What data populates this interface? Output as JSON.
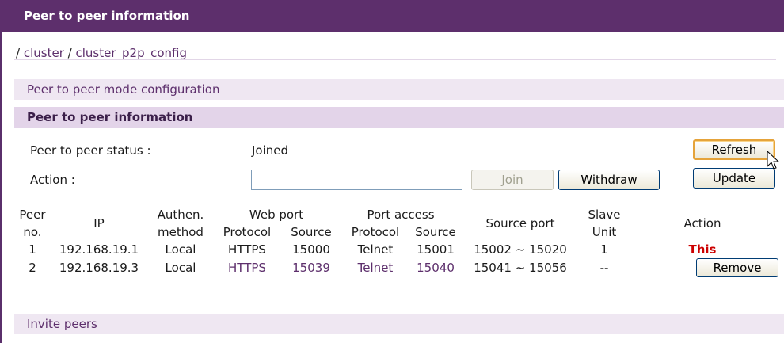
{
  "title": "Peer to peer information",
  "breadcrumb": {
    "sep": "/",
    "item1": "cluster",
    "item2": "cluster_p2p_config"
  },
  "sections": {
    "config": "Peer to peer mode configuration",
    "info": "Peer to peer information",
    "invite": "Invite peers"
  },
  "status": {
    "label": "Peer to peer status :",
    "value": "Joined"
  },
  "action": {
    "label": "Action :",
    "input_value": ""
  },
  "buttons": {
    "join": "Join",
    "withdraw": "Withdraw",
    "refresh": "Refresh",
    "update": "Update"
  },
  "table": {
    "headers": {
      "peer": "Peer",
      "no": "no.",
      "ip": "IP",
      "authen": "Authen.",
      "method": "method",
      "web_port": "Web port",
      "port_access": "Port access",
      "protocol": "Protocol",
      "source": "Source",
      "source_port": "Source port",
      "slave": "Slave",
      "unit": "Unit",
      "action": "Action"
    },
    "rows": [
      {
        "no": "1",
        "ip": "192.168.19.1",
        "method": "Local",
        "web_protocol": "HTTPS",
        "web_source": "15000",
        "access_protocol": "Telnet",
        "access_source": "15001",
        "source_port": "15002 ~ 15020",
        "slave": "1",
        "action": "This"
      },
      {
        "no": "2",
        "ip": "192.168.19.3",
        "method": "Local",
        "web_protocol": "HTTPS",
        "web_source": "15039",
        "access_protocol": "Telnet",
        "access_source": "15040",
        "source_port": "15041 ~ 15056",
        "slave": "--",
        "action": "Remove"
      }
    ]
  },
  "colors": {
    "title_bg": "#5d2f6c",
    "section_light": "#efe7f2",
    "section_med": "#e3d4e9",
    "link": "#5d2f6c",
    "this_text": "#cc0000"
  }
}
